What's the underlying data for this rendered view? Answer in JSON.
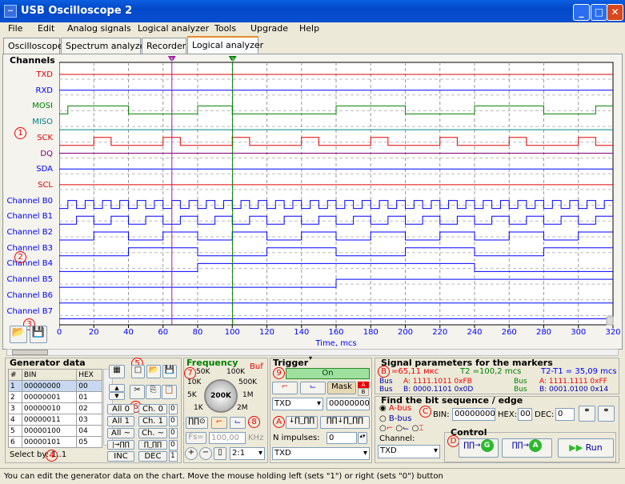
{
  "window": {
    "title": "USB Oscilloscope 2",
    "icon": "oscilloscope-icon"
  },
  "menu": [
    "File",
    "Edit",
    "Analog signals",
    "Logical analyzer",
    "Tools",
    "Upgrade",
    "Help"
  ],
  "tabs": [
    "Oscilloscope",
    "Spectrum analyzer",
    "Recorder",
    "Logical analyzer"
  ],
  "channels": {
    "title": "Channels",
    "names": [
      {
        "name": "TXD",
        "color": "#e00000"
      },
      {
        "name": "RXD",
        "color": "#0000ff"
      },
      {
        "name": "MOSI",
        "color": "#008000"
      },
      {
        "name": "MISO",
        "color": "#008080"
      },
      {
        "name": "SCK",
        "color": "#e00000"
      },
      {
        "name": "DQ",
        "color": "#800080"
      },
      {
        "name": "SDA",
        "color": "#0000ff"
      },
      {
        "name": "SCL",
        "color": "#e00000"
      },
      {
        "name": "Channel B0",
        "color": "#0000ff"
      },
      {
        "name": "Channel B1",
        "color": "#0000ff"
      },
      {
        "name": "Channel B2",
        "color": "#0000ff"
      },
      {
        "name": "Channel B3",
        "color": "#0000ff"
      },
      {
        "name": "Channel B4",
        "color": "#0000ff"
      },
      {
        "name": "Channel B5",
        "color": "#0000ff"
      },
      {
        "name": "Channel B6",
        "color": "#0000ff"
      },
      {
        "name": "Channel B7",
        "color": "#0000ff"
      }
    ]
  },
  "markers": {
    "m1": "1",
    "m2": "2",
    "m1_time": 65.11,
    "m2_time": 100.2
  },
  "xaxis": {
    "label": "Time, mcs",
    "ticks": [
      "0",
      "20",
      "40",
      "60",
      "80",
      "100",
      "120",
      "140",
      "160",
      "180",
      "200",
      "220",
      "240",
      "260",
      "280",
      "300",
      "320"
    ]
  },
  "callouts": [
    "1",
    "2",
    "3",
    "4",
    "5",
    "6",
    "7",
    "8",
    "9",
    "A",
    "B",
    "C",
    "D"
  ],
  "generator": {
    "title": "Generator data",
    "headers": [
      "#",
      "BIN",
      "HEX"
    ],
    "rows": [
      [
        "1",
        "00000000",
        "00"
      ],
      [
        "2",
        "00000001",
        "01"
      ],
      [
        "3",
        "00000010",
        "02"
      ],
      [
        "4",
        "00000011",
        "03"
      ],
      [
        "5",
        "00000100",
        "04"
      ],
      [
        "6",
        "00000101",
        "05"
      ]
    ],
    "select_by": "Select by: 1..1",
    "btn_all0": "All 0",
    "btn_all1": "All 1",
    "btn_alltilde": "All ~",
    "btn_ch0": "Ch. 0",
    "btn_ch1": "Ch. 1",
    "btn_chtilde": "Ch. ~",
    "btn_inc": "INC",
    "btn_dec": "DEC",
    "side_vals": [
      "0",
      "0",
      "0",
      "0",
      "1"
    ]
  },
  "frequency": {
    "title": "Frequency",
    "buf": "Buf",
    "dial_value": "200K",
    "ticks": [
      "50K",
      "100K",
      "10K",
      "500K",
      "5K",
      "1M",
      "1K",
      "2M"
    ],
    "fs_label": "Fs=",
    "fs_value": "100,00",
    "fs_unit": "KHz",
    "ratio": "2:1"
  },
  "trigger": {
    "title": "Trigger",
    "status": "On",
    "mask_label": "Mask",
    "channel": "TXD",
    "mask_value": "00000000",
    "n_impulses_label": "N impulses:",
    "n_impulses_value": "0",
    "channel2": "TXD"
  },
  "signal": {
    "title": "Signal parameters for the markers",
    "t1": "=65,11 мкс",
    "t2": "T2 =100,2 mcs",
    "dt": "T2-T1 = 35,09 mcs",
    "bus_rows": [
      {
        "left": "Bus",
        "mid": "A: 1111.1011 0xFB",
        "r1": "Bus",
        "r2": "A: 1111.1111 0xFF"
      },
      {
        "left": "Bus",
        "mid": "B: 0000.1101 0x0D",
        "r1": "Bus",
        "r2": "B: 0001.0100 0x14"
      }
    ]
  },
  "find": {
    "title": "Find the bit sequence / edge",
    "a_bus": "A-bus",
    "b_bus": "B-bus",
    "bin_label": "BIN:",
    "bin_value": "00000000",
    "hex_label": "HEX:",
    "hex_value": "00",
    "dec_label": "DEC:",
    "dec_value": "0",
    "channel_label": "Channel:",
    "channel_value": "TXD"
  },
  "control": {
    "title": "Control",
    "run": "Run"
  },
  "status": "You can edit the generator data on the chart. Move the mouse holding left (sets \"1\") or right (sets \"0\") button"
}
